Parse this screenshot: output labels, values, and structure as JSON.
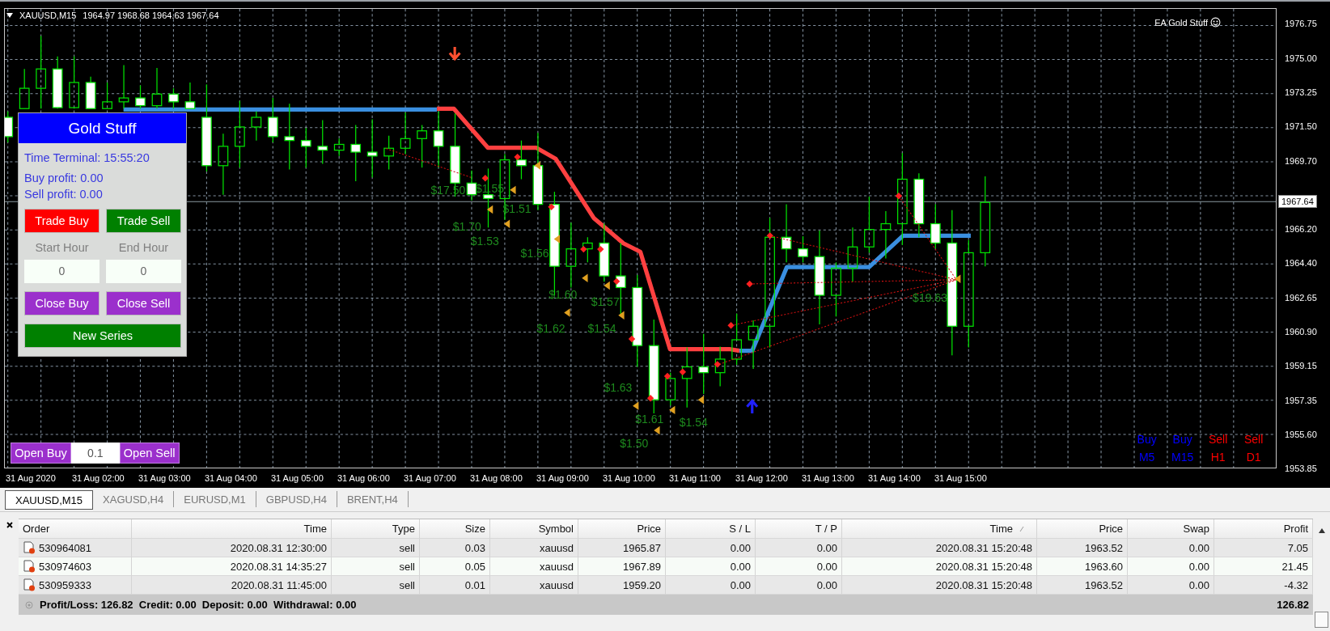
{
  "chart": {
    "symbol": "XAUUSD,M15",
    "ohlc": "1964.97 1968.68 1964.63 1967.64",
    "expert": "EA Gold Stuff",
    "price_ticks": [
      "1976.75",
      "1975.00",
      "1973.25",
      "1971.50",
      "1969.70",
      "1966.20",
      "1964.40",
      "1962.65",
      "1960.90",
      "1959.15",
      "1957.35",
      "1955.60",
      "1953.85"
    ],
    "current_price": "1967.64",
    "time_ticks": [
      "31 Aug 2020",
      "31 Aug 02:00",
      "31 Aug 03:00",
      "31 Aug 04:00",
      "31 Aug 05:00",
      "31 Aug 06:00",
      "31 Aug 07:00",
      "31 Aug 08:00",
      "31 Aug 09:00",
      "31 Aug 10:00",
      "31 Aug 11:00",
      "31 Aug 12:00",
      "31 Aug 13:00",
      "31 Aug 14:00",
      "31 Aug 15:00"
    ],
    "profit_labels": [
      "$17.50",
      "$1.55",
      "$1.51",
      "$1.70",
      "$1.53",
      "$1.56",
      "$1.60",
      "$1.57",
      "$1.62",
      "$1.54",
      "$1.63",
      "$1.61",
      "$1.54",
      "$1.50",
      "$19.63"
    ],
    "signals": [
      {
        "label": "Buy",
        "timeframe": "M5",
        "color": "#0000ff"
      },
      {
        "label": "Buy",
        "timeframe": "M15",
        "color": "#0000ff"
      },
      {
        "label": "Sell",
        "timeframe": "H1",
        "color": "#ff0000"
      },
      {
        "label": "Sell",
        "timeframe": "D1",
        "color": "#ff0000"
      }
    ]
  },
  "panel": {
    "title": "Gold Stuff",
    "time_terminal": "Time Terminal: 15:55:20",
    "buy_profit": "Buy profit: 0.00",
    "sell_profit": "Sell profit: 0.00",
    "trade_buttons": [
      {
        "label": "Trade Buy",
        "color": "#ff0000"
      },
      {
        "label": "Trade Sell",
        "color": "#008000"
      }
    ],
    "hour_fields": [
      {
        "label": "Start Hour",
        "value": "0"
      },
      {
        "label": "End Hour",
        "value": "0"
      }
    ],
    "close_buttons": [
      "Close Buy",
      "Close Sell"
    ],
    "new_series": "New Series"
  },
  "quick_trade": {
    "buy": "Open Buy",
    "lots": "0.1",
    "sell": "Open Sell"
  },
  "tabs": [
    {
      "label": "XAUUSD,M15",
      "selected": true
    },
    {
      "label": "XAGUSD,H4",
      "selected": false
    },
    {
      "label": "EURUSD,M1",
      "selected": false
    },
    {
      "label": "GBPUSD,H4",
      "selected": false
    },
    {
      "label": "BRENT,H4",
      "selected": false
    }
  ],
  "table": {
    "columns": [
      "Order",
      "Time",
      "Type",
      "Size",
      "Symbol",
      "Price",
      "S / L",
      "T / P",
      "Time",
      "Price",
      "Swap",
      "Profit"
    ],
    "rows": [
      [
        "530964081",
        "2020.08.31 12:30:00",
        "sell",
        "0.03",
        "xauusd",
        "1965.87",
        "0.00",
        "0.00",
        "2020.08.31 15:20:48",
        "1963.52",
        "0.00",
        "7.05"
      ],
      [
        "530974603",
        "2020.08.31 14:35:27",
        "sell",
        "0.05",
        "xauusd",
        "1967.89",
        "0.00",
        "0.00",
        "2020.08.31 15:20:48",
        "1963.60",
        "0.00",
        "21.45"
      ],
      [
        "530959333",
        "2020.08.31 11:45:00",
        "sell",
        "0.01",
        "xauusd",
        "1959.20",
        "0.00",
        "0.00",
        "2020.08.31 15:20:48",
        "1963.52",
        "0.00",
        "-4.32"
      ]
    ],
    "summary": "Profit/Loss: 126.82  Credit: 0.00  Deposit: 0.00  Withdrawal: 0.00",
    "total": "126.82"
  }
}
